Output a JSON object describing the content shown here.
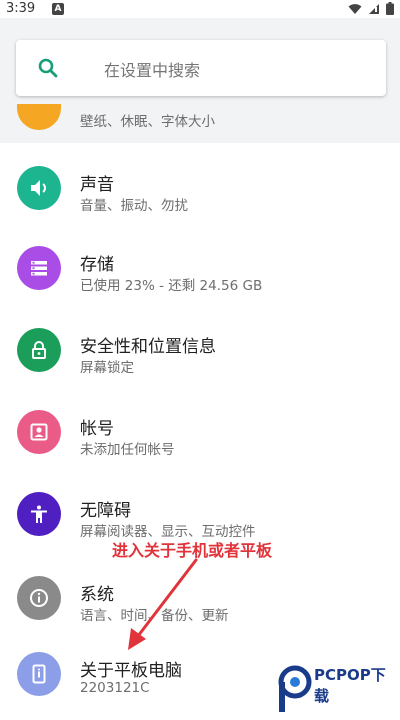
{
  "status_bar": {
    "time": "3:39",
    "notification_letter": "A"
  },
  "search": {
    "placeholder": "在设置中搜索"
  },
  "partial_item": {
    "subtitle": "壁纸、休眠、字体大小",
    "icon": "display-icon",
    "color": "#f5a623"
  },
  "items": [
    {
      "title": "声音",
      "subtitle": "音量、振动、勿扰",
      "icon": "volume-icon",
      "color": "#1db58f"
    },
    {
      "title": "存储",
      "subtitle": "已使用 23% - 还剩 24.56 GB",
      "icon": "storage-icon",
      "color": "#a94de6"
    },
    {
      "title": "安全性和位置信息",
      "subtitle": "屏幕锁定",
      "icon": "lock-icon",
      "color": "#1a9e5a"
    },
    {
      "title": "帐号",
      "subtitle": "未添加任何帐号",
      "icon": "account-icon",
      "color": "#ea5b87"
    },
    {
      "title": "无障碍",
      "subtitle": "屏幕阅读器、显示、互动控件",
      "icon": "accessibility-icon",
      "color": "#4f1fc1"
    },
    {
      "title": "系统",
      "subtitle": "语言、时间、备份、更新",
      "icon": "info-icon",
      "color": "#8a8a8a"
    },
    {
      "title": "关于平板电脑",
      "subtitle": "2203121C",
      "icon": "tablet-icon",
      "color": "#8c9ee8"
    }
  ],
  "annotation": {
    "text": "进入关于手机或者平板",
    "color": "#e0333a"
  },
  "watermark": {
    "text": "PCPOP下载"
  }
}
